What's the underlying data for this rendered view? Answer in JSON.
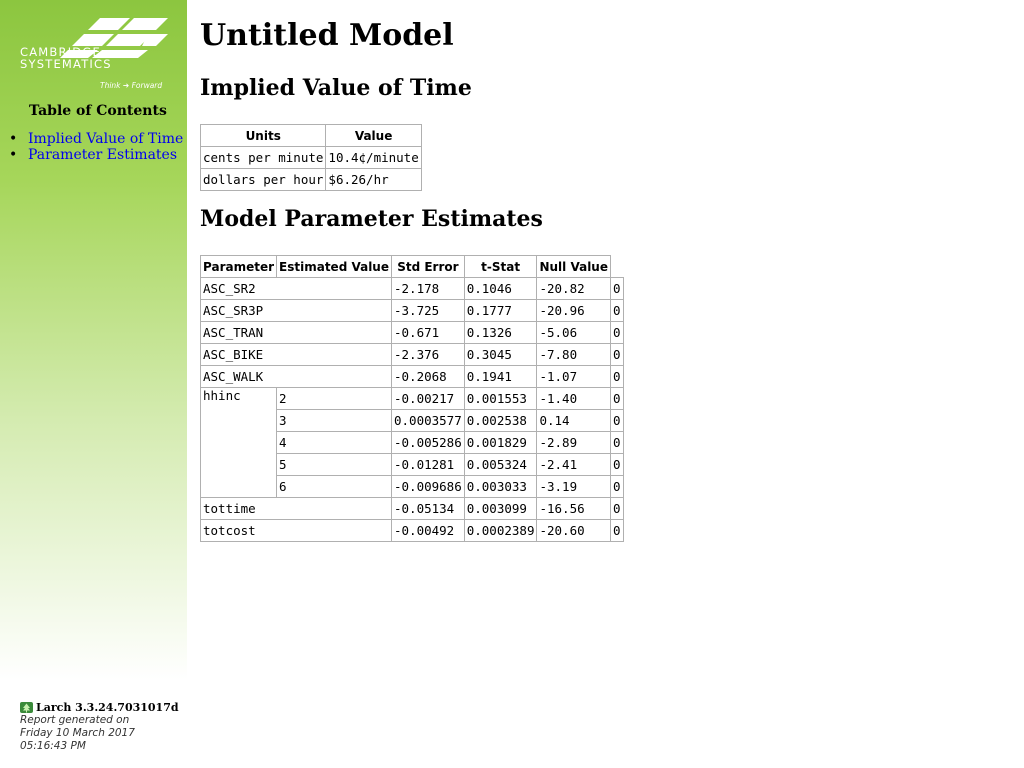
{
  "sidebar": {
    "logo": {
      "line1": "CAMBRIDGE",
      "line2": "SYSTEMATICS",
      "tag_think": "Think",
      "tag_forward": "Forward"
    },
    "toc_title": "Table of Contents",
    "toc_items": [
      {
        "label": "Implied Value of Time"
      },
      {
        "label": "Parameter Estimates"
      }
    ],
    "footer": {
      "version": "Larch 3.3.24.7031017d",
      "generated_line1": "Report generated on",
      "generated_line2": "Friday 10 March 2017",
      "generated_line3": "05:16:43 PM"
    }
  },
  "main": {
    "title": "Untitled Model",
    "vot": {
      "heading": "Implied Value of Time",
      "headers": [
        "Units",
        "Value"
      ],
      "rows": [
        [
          "cents per minute",
          "10.4¢/minute"
        ],
        [
          "dollars per hour",
          "$6.26/hr"
        ]
      ]
    },
    "params": {
      "heading": "Model Parameter Estimates",
      "headers": [
        "Parameter",
        "Estimated Value",
        "Std Error",
        "t-Stat",
        "Null Value"
      ],
      "rows": [
        {
          "name": "ASC_SR2",
          "sub": "",
          "est": "-2.178",
          "se": "0.1046",
          "t": "-20.82",
          "null": "0"
        },
        {
          "name": "ASC_SR3P",
          "sub": "",
          "est": "-3.725",
          "se": "0.1777",
          "t": "-20.96",
          "null": "0"
        },
        {
          "name": "ASC_TRAN",
          "sub": "",
          "est": "-0.671",
          "se": "0.1326",
          "t": "-5.06",
          "null": "0"
        },
        {
          "name": "ASC_BIKE",
          "sub": "",
          "est": "-2.376",
          "se": "0.3045",
          "t": "-7.80",
          "null": "0"
        },
        {
          "name": "ASC_WALK",
          "sub": "",
          "est": "-0.2068",
          "se": "0.1941",
          "t": "-1.07",
          "null": "0"
        },
        {
          "name": "hhinc",
          "sub": "2",
          "est": "-0.00217",
          "se": "0.001553",
          "t": "-1.40",
          "null": "0"
        },
        {
          "name": "",
          "sub": "3",
          "est": "0.0003577",
          "se": "0.002538",
          "t": "0.14",
          "null": "0"
        },
        {
          "name": "",
          "sub": "4",
          "est": "-0.005286",
          "se": "0.001829",
          "t": "-2.89",
          "null": "0"
        },
        {
          "name": "",
          "sub": "5",
          "est": "-0.01281",
          "se": "0.005324",
          "t": "-2.41",
          "null": "0"
        },
        {
          "name": "",
          "sub": "6",
          "est": "-0.009686",
          "se": "0.003033",
          "t": "-3.19",
          "null": "0"
        },
        {
          "name": "tottime",
          "sub": "",
          "est": "-0.05134",
          "se": "0.003099",
          "t": "-16.56",
          "null": "0"
        },
        {
          "name": "totcost",
          "sub": "",
          "est": "-0.00492",
          "se": "0.0002389",
          "t": "-20.60",
          "null": "0"
        }
      ]
    }
  }
}
